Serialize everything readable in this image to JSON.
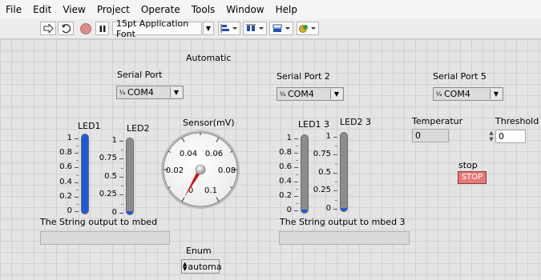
{
  "menubar": [
    "File",
    "Edit",
    "View",
    "Project",
    "Operate",
    "Tools",
    "Window",
    "Help"
  ],
  "toolbar": {
    "font_selector": "15pt Application Font",
    "icons": [
      "run-arrow-icon",
      "run-continuously-icon",
      "abort-icon",
      "pause-icon",
      "align-icon",
      "distribute-icon",
      "resize-icon",
      "reorder-icon"
    ]
  },
  "panel": {
    "automatic_label": "Automatic",
    "serial_port": {
      "label": "Serial Port",
      "value": "COM4"
    },
    "serial_port_2": {
      "label": "Serial Port 2",
      "value": "COM4"
    },
    "serial_port_5": {
      "label": "Serial Port 5",
      "value": "COM4"
    },
    "led1": {
      "label": "LED1",
      "ticks": [
        "1",
        "0.8",
        "0.6",
        "0.4",
        "0.2",
        "0"
      ],
      "level": 1
    },
    "led2": {
      "label": "LED2",
      "ticks": [
        "1",
        "0.75",
        "0.5",
        "0.25",
        "0"
      ],
      "level": 0
    },
    "led1_3": {
      "label": "LED1 3",
      "ticks": [
        "1",
        "0.8",
        "0.6",
        "0.4",
        "0.2",
        "0"
      ],
      "level": 0
    },
    "led2_3": {
      "label": "LED2 3",
      "ticks": [
        "1",
        "0.75",
        "0.5",
        "0.25",
        "0"
      ],
      "level": 0
    },
    "sensor": {
      "label": "Sensor(mV)",
      "ticks": [
        "0",
        "0.02",
        "0.04",
        "0.06",
        "0.08",
        "0.1"
      ],
      "value": 0
    },
    "string_output": {
      "label": "The String output to mbed",
      "value": ""
    },
    "string_output_3": {
      "label": "The String output to mbed 3",
      "value": ""
    },
    "enum": {
      "label": "Enum",
      "value": "automa"
    },
    "temperature": {
      "label": "Temperatur",
      "value": "0"
    },
    "threshold": {
      "label": "Threshold",
      "value": "0"
    },
    "stop": {
      "label": "stop",
      "button": "STOP"
    }
  },
  "colors": {
    "tank_fill": "#1e5ad8",
    "stop_button": "#e87878",
    "needle": "#d81010",
    "grid_bg": "#e4e4e4"
  }
}
